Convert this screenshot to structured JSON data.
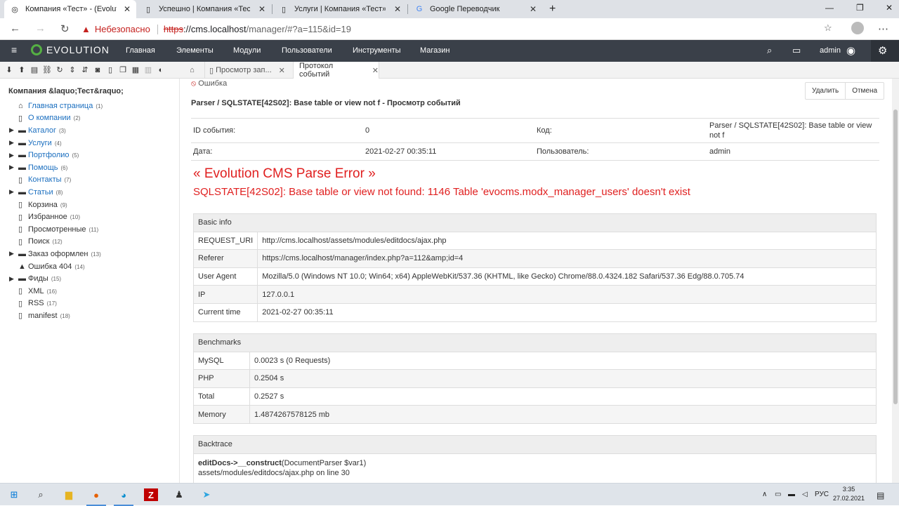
{
  "browser": {
    "tabs": [
      {
        "title": "Компания «Тест» - (Evolution CMS",
        "active": true,
        "icon": "evolution-logo-icon"
      },
      {
        "title": "Успешно | Компания «Тест»",
        "active": false,
        "icon": "page-icon"
      },
      {
        "title": "Услуги | Компания «Тест»",
        "active": false,
        "icon": "page-icon"
      },
      {
        "title": "Google Переводчик",
        "active": false,
        "icon": "google-translate-icon"
      }
    ],
    "address": {
      "security": "Небезопасно",
      "scheme": "https",
      "host": "cms.localhost",
      "path": "/manager/#?a=115&id=19"
    }
  },
  "navbar": {
    "brand": "EVOLUTION",
    "menu": [
      "Главная",
      "Элементы",
      "Модули",
      "Пользователи",
      "Инструменты",
      "Магазин"
    ],
    "user": "admin"
  },
  "doc_tabs": [
    {
      "title": "Просмотр зап...",
      "active": false
    },
    {
      "title": "Протокол событий",
      "active": true
    }
  ],
  "sidebar": {
    "site_name": "Компания &laquo;Тест&raquo;",
    "items": [
      {
        "label": "Главная страница",
        "count": "(1)",
        "icon": "home-icon",
        "expand": false,
        "style": "blue"
      },
      {
        "label": "О компании",
        "count": "(2)",
        "icon": "page-icon",
        "expand": false,
        "style": "blue"
      },
      {
        "label": "Каталог",
        "count": "(3)",
        "icon": "folder-icon",
        "expand": true,
        "style": "blue"
      },
      {
        "label": "Услуги",
        "count": "(4)",
        "icon": "folder-icon",
        "expand": true,
        "style": "blue"
      },
      {
        "label": "Портфолио",
        "count": "(5)",
        "icon": "folder-icon",
        "expand": true,
        "style": "blue"
      },
      {
        "label": "Помощь",
        "count": "(6)",
        "icon": "folder-icon",
        "expand": true,
        "style": "blue"
      },
      {
        "label": "Контакты",
        "count": "(7)",
        "icon": "page-icon",
        "expand": false,
        "style": "blue"
      },
      {
        "label": "Статьи",
        "count": "(8)",
        "icon": "folder-icon",
        "expand": true,
        "style": "blue"
      },
      {
        "label": "Корзина",
        "count": "(9)",
        "icon": "page-icon",
        "expand": false,
        "style": "dark"
      },
      {
        "label": "Избранное",
        "count": "(10)",
        "icon": "page-icon",
        "expand": false,
        "style": "dark"
      },
      {
        "label": "Просмотренные",
        "count": "(11)",
        "icon": "page-icon",
        "expand": false,
        "style": "dark"
      },
      {
        "label": "Поиск",
        "count": "(12)",
        "icon": "page-icon",
        "expand": false,
        "style": "dark"
      },
      {
        "label": "Заказ оформлен",
        "count": "(13)",
        "icon": "folder-icon",
        "expand": true,
        "style": "dark"
      },
      {
        "label": "Ошибка 404",
        "count": "(14)",
        "icon": "warning-icon",
        "expand": false,
        "style": "dark"
      },
      {
        "label": "Фиды",
        "count": "(15)",
        "icon": "folder-icon",
        "expand": true,
        "style": "dark"
      },
      {
        "label": "XML",
        "count": "(16)",
        "icon": "page-icon",
        "expand": false,
        "style": "dark"
      },
      {
        "label": "RSS",
        "count": "(17)",
        "icon": "page-icon",
        "expand": false,
        "style": "dark"
      },
      {
        "label": "manifest",
        "count": "(18)",
        "icon": "page-icon",
        "expand": false,
        "style": "dark"
      }
    ]
  },
  "event": {
    "error_label": "Ошибка",
    "headline": "Parser / SQLSTATE[42S02]: Base table or view not f - Просмотр событий",
    "delete_label": "Удалить",
    "cancel_label": "Отмена",
    "id_label": "ID события:",
    "id_value": "0",
    "code_label": "Код:",
    "code_value": "Parser / SQLSTATE[42S02]: Base table or view not f",
    "date_label": "Дата:",
    "date_value": "2021-02-27 00:35:11",
    "user_label": "Пользователь:",
    "user_value": "admin"
  },
  "parse_error": {
    "title": "« Evolution CMS Parse Error »",
    "message": "SQLSTATE[42S02]: Base table or view not found: 1146 Table 'evocms.modx_manager_users' doesn't exist"
  },
  "basic_info": {
    "header": "Basic info",
    "rows": [
      {
        "k": "REQUEST_URI",
        "v": "http://cms.localhost/assets/modules/editdocs/ajax.php"
      },
      {
        "k": "Referer",
        "v": "https://cms.localhost/manager/index.php?a=112&amp;id=4"
      },
      {
        "k": "User Agent",
        "v": "Mozilla/5.0 (Windows NT 10.0; Win64; x64) AppleWebKit/537.36 (KHTML, like Gecko) Chrome/88.0.4324.182 Safari/537.36 Edg/88.0.705.74"
      },
      {
        "k": "IP",
        "v": "127.0.0.1"
      },
      {
        "k": "Current time",
        "v": "2021-02-27 00:35:11"
      }
    ]
  },
  "benchmarks": {
    "header": "Benchmarks",
    "rows": [
      {
        "k": "MySQL",
        "v": "0.0023 s (0 Requests)"
      },
      {
        "k": "PHP",
        "v": "0.2504 s"
      },
      {
        "k": "Total",
        "v": "0.2527 s"
      },
      {
        "k": "Memory",
        "v": "1.4874267578125 mb"
      }
    ]
  },
  "backtrace": {
    "header": "Backtrace",
    "func": "editDocs->__construct",
    "args": "(DocumentParser $var1)",
    "file": "assets/modules/editdocs/ajax.php on line 30"
  },
  "taskbar": {
    "lang": "РУС",
    "time": "3:35",
    "date": "27.02.2021"
  }
}
